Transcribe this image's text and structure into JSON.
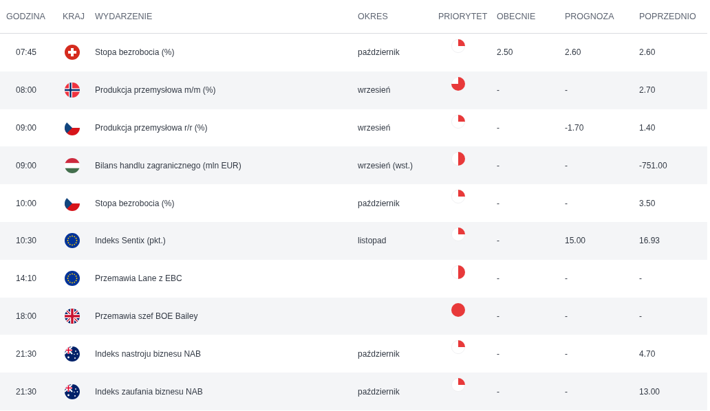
{
  "columns": [
    "GODZINA",
    "KRAJ",
    "WYDARZENIE",
    "OKRES",
    "PRIORYTET",
    "OBECNIE",
    "PROGNOZA",
    "POPRZEDNIO"
  ],
  "rows": [
    {
      "time": "07:45",
      "flag": {
        "kind": "ch"
      },
      "event": "Stopa bezrobocia (%)",
      "period": "październik",
      "priority": {
        "kind": "quarter"
      },
      "actual": "2.50",
      "forecast": "2.60",
      "previous": "2.60"
    },
    {
      "time": "08:00",
      "flag": {
        "kind": "no"
      },
      "event": "Produkcja przemysłowa m/m (%)",
      "period": "wrzesień",
      "priority": {
        "kind": "three-quarters"
      },
      "actual": "-",
      "forecast": "-",
      "previous": "2.70"
    },
    {
      "time": "09:00",
      "flag": {
        "kind": "cz"
      },
      "event": "Produkcja przemysłowa r/r (%)",
      "period": "wrzesień",
      "priority": {
        "kind": "quarter"
      },
      "actual": "-",
      "forecast": "-1.70",
      "previous": "1.40"
    },
    {
      "time": "09:00",
      "flag": {
        "kind": "hu"
      },
      "event": "Bilans handlu zagranicznego (mln EUR)",
      "period": "wrzesień (wst.)",
      "priority": {
        "kind": "half"
      },
      "actual": "-",
      "forecast": "-",
      "previous": "-751.00"
    },
    {
      "time": "10:00",
      "flag": {
        "kind": "cz"
      },
      "event": "Stopa bezrobocia (%)",
      "period": "październik",
      "priority": {
        "kind": "quarter"
      },
      "actual": "-",
      "forecast": "-",
      "previous": "3.50"
    },
    {
      "time": "10:30",
      "flag": {
        "kind": "eu"
      },
      "event": "Indeks Sentix (pkt.)",
      "period": "listopad",
      "priority": {
        "kind": "quarter"
      },
      "actual": "-",
      "forecast": "15.00",
      "previous": "16.93"
    },
    {
      "time": "14:10",
      "flag": {
        "kind": "eu"
      },
      "event": "Przemawia Lane z EBC",
      "priority": {
        "kind": "half"
      },
      "actual": "-",
      "forecast": "-",
      "previous": "-"
    },
    {
      "time": "18:00",
      "flag": {
        "kind": "gb"
      },
      "event": "Przemawia szef BOE Bailey",
      "priority": {
        "kind": "full"
      },
      "actual": "-",
      "forecast": "-",
      "previous": "-"
    },
    {
      "time": "21:30",
      "flag": {
        "kind": "au"
      },
      "event": "Indeks nastroju biznesu NAB",
      "period": "październik",
      "priority": {
        "kind": "quarter"
      },
      "actual": "-",
      "forecast": "-",
      "previous": "4.70"
    },
    {
      "time": "21:30",
      "flag": {
        "kind": "au"
      },
      "event": "Indeks zaufania biznesu NAB",
      "period": "październik",
      "priority": {
        "kind": "quarter"
      },
      "actual": "-",
      "forecast": "-",
      "previous": "13.00"
    }
  ]
}
